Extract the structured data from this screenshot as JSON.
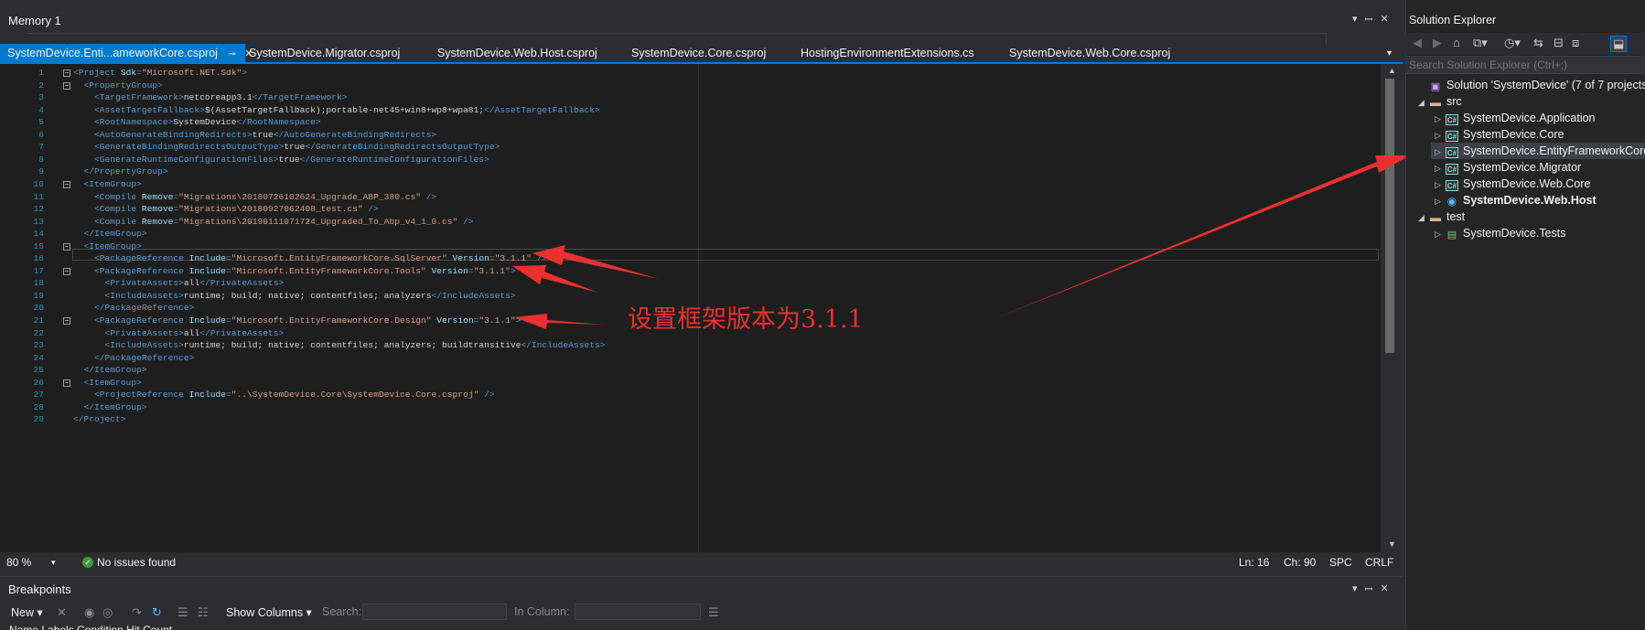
{
  "memory_panel": {
    "title": "Memory 1",
    "pin_icon": "▾ ⨯"
  },
  "tabs": [
    {
      "label": "SystemDevice.Enti...ameworkCore.csproj",
      "active": true
    },
    {
      "label": "SystemDevice.Migrator.csproj"
    },
    {
      "label": "SystemDevice.Web.Host.csproj"
    },
    {
      "label": "SystemDevice.Core.csproj"
    },
    {
      "label": "HostingEnvironmentExtensions.cs"
    },
    {
      "label": "SystemDevice.Web.Core.csproj"
    }
  ],
  "editor": {
    "line_numbers": [
      "1",
      "2",
      "3",
      "4",
      "5",
      "6",
      "7",
      "8",
      "9",
      "10",
      "11",
      "12",
      "13",
      "14",
      "15",
      "16",
      "17",
      "18",
      "19",
      "20",
      "21",
      "22",
      "23",
      "24",
      "25",
      "26",
      "27",
      "28",
      "29"
    ],
    "lines": [
      [
        [
          "t",
          "<Project "
        ],
        [
          "a",
          "Sdk"
        ],
        [
          "p",
          "="
        ],
        [
          "v",
          "\"Microsoft.NET.Sdk\""
        ],
        [
          "t",
          ">"
        ]
      ],
      [
        [
          "t",
          "  <PropertyGroup>"
        ]
      ],
      [
        [
          "t",
          "    <TargetFramework>"
        ],
        [
          "x",
          "netcoreapp3.1"
        ],
        [
          "t",
          "</TargetFramework>"
        ]
      ],
      [
        [
          "t",
          "    <AssetTargetFallback>"
        ],
        [
          "x",
          "$(AssetTargetFallback);portable-net45+win8+wp8+wpa81;"
        ],
        [
          "t",
          "</AssetTargetFallback>"
        ]
      ],
      [
        [
          "t",
          "    <RootNamespace>"
        ],
        [
          "x",
          "SystemDevice"
        ],
        [
          "t",
          "</RootNamespace>"
        ]
      ],
      [
        [
          "t",
          "    <AutoGenerateBindingRedirects>"
        ],
        [
          "x",
          "true"
        ],
        [
          "t",
          "</AutoGenerateBindingRedirects>"
        ]
      ],
      [
        [
          "t",
          "    <GenerateBindingRedirectsOutputType>"
        ],
        [
          "x",
          "true"
        ],
        [
          "t",
          "</GenerateBindingRedirectsOutputType>"
        ]
      ],
      [
        [
          "t",
          "    <GenerateRuntimeConfigurationFiles>"
        ],
        [
          "x",
          "true"
        ],
        [
          "t",
          "</GenerateRuntimeConfigurationFiles>"
        ]
      ],
      [
        [
          "t",
          "  </PropertyGroup>"
        ]
      ],
      [
        [
          "t",
          "  <ItemGroup>"
        ]
      ],
      [
        [
          "t",
          "    <Compile "
        ],
        [
          "a",
          "Remove"
        ],
        [
          "p",
          "="
        ],
        [
          "v",
          "\"Migrations\\20180726102624_Upgrade_ABP_380.cs\""
        ],
        [
          "t",
          " />"
        ]
      ],
      [
        [
          "t",
          "    <Compile "
        ],
        [
          "a",
          "Remove"
        ],
        [
          "p",
          "="
        ],
        [
          "v",
          "\"Migrations\\20180927062408_test.cs\""
        ],
        [
          "t",
          " />"
        ]
      ],
      [
        [
          "t",
          "    <Compile "
        ],
        [
          "a",
          "Remove"
        ],
        [
          "p",
          "="
        ],
        [
          "v",
          "\"Migrations\\20190111071724_Upgraded_To_Abp_v4_1_0.cs\""
        ],
        [
          "t",
          " />"
        ]
      ],
      [
        [
          "t",
          "  </ItemGroup>"
        ]
      ],
      [
        [
          "t",
          "  <ItemGroup>"
        ]
      ],
      [
        [
          "t",
          "    <PackageReference "
        ],
        [
          "a",
          "Include"
        ],
        [
          "p",
          "="
        ],
        [
          "v",
          "\"Microsoft.EntityFrameworkCore.SqlServer\""
        ],
        [
          "a",
          " Version"
        ],
        [
          "p",
          "="
        ],
        [
          "v",
          "\"3.1.1\""
        ],
        [
          "t",
          " />"
        ]
      ],
      [
        [
          "t",
          "    <PackageReference "
        ],
        [
          "a",
          "Include"
        ],
        [
          "p",
          "="
        ],
        [
          "v",
          "\"Microsoft.EntityFrameworkCore.Tools\""
        ],
        [
          "a",
          " Version"
        ],
        [
          "p",
          "="
        ],
        [
          "v",
          "\"3.1.1\""
        ],
        [
          "t",
          ">"
        ]
      ],
      [
        [
          "t",
          "      <PrivateAssets>"
        ],
        [
          "x",
          "all"
        ],
        [
          "t",
          "</PrivateAssets>"
        ]
      ],
      [
        [
          "t",
          "      <IncludeAssets>"
        ],
        [
          "x",
          "runtime; build; native; contentfiles; analyzers"
        ],
        [
          "t",
          "</IncludeAssets>"
        ]
      ],
      [
        [
          "t",
          "    </PackageReference>"
        ]
      ],
      [
        [
          "t",
          "    <PackageReference "
        ],
        [
          "a",
          "Include"
        ],
        [
          "p",
          "="
        ],
        [
          "v",
          "\"Microsoft.EntityFrameworkCore.Design\""
        ],
        [
          "a",
          " Version"
        ],
        [
          "p",
          "="
        ],
        [
          "v",
          "\"3.1.1\""
        ],
        [
          "t",
          ">"
        ]
      ],
      [
        [
          "t",
          "      <PrivateAssets>"
        ],
        [
          "x",
          "all"
        ],
        [
          "t",
          "</PrivateAssets>"
        ]
      ],
      [
        [
          "t",
          "      <IncludeAssets>"
        ],
        [
          "x",
          "runtime; build; native; contentfiles; analyzers; buildtransitive"
        ],
        [
          "t",
          "</IncludeAssets>"
        ]
      ],
      [
        [
          "t",
          "    </PackageReference>"
        ]
      ],
      [
        [
          "t",
          "  </ItemGroup>"
        ]
      ],
      [
        [
          "t",
          "  <ItemGroup>"
        ]
      ],
      [
        [
          "t",
          "    <ProjectReference "
        ],
        [
          "a",
          "Include"
        ],
        [
          "p",
          "="
        ],
        [
          "v",
          "\"..\\SystemDevice.Core\\SystemDevice.Core.csproj\""
        ],
        [
          "t",
          " />"
        ]
      ],
      [
        [
          "t",
          "  </ItemGroup>"
        ]
      ],
      [
        [
          "t",
          "</Project>"
        ]
      ]
    ]
  },
  "annotation": {
    "text": "设置框架版本为3.1.1",
    "color": "#e8312f"
  },
  "status_bar": {
    "zoom": "80 %",
    "issues": "No issues found",
    "line": "Ln: 16",
    "col": "Ch: 90",
    "whitespace": "SPC",
    "eol": "CRLF"
  },
  "breakpoints": {
    "title": "Breakpoints",
    "new_label": "New",
    "show_columns_label": "Show Columns",
    "search_label": "Search:",
    "in_column_label": "In Column:",
    "columns_row": "Name    Labels    Condition    Hit Count"
  },
  "solution_explorer": {
    "title": "Solution Explorer",
    "search_placeholder": "Search Solution Explorer (Ctrl+;)",
    "items": [
      {
        "label": "Solution 'SystemDevice' (7 of 7 projects)",
        "icon": "solution-icon",
        "caret": ""
      },
      {
        "label": "src",
        "icon": "folder-icon",
        "caret": "◢"
      },
      {
        "label": "SystemDevice.Application",
        "icon": "csharp-project-icon",
        "caret": "▷"
      },
      {
        "label": "SystemDevice.Core",
        "icon": "csharp-project-icon",
        "caret": "▷"
      },
      {
        "label": "SystemDevice.EntityFrameworkCore",
        "icon": "csharp-project-icon",
        "caret": "▷",
        "selected": true
      },
      {
        "label": "SystemDevice.Migrator",
        "icon": "csharp-project-icon",
        "caret": "▷"
      },
      {
        "label": "SystemDevice.Web.Core",
        "icon": "csharp-project-icon",
        "caret": "▷"
      },
      {
        "label": "SystemDevice.Web.Host",
        "icon": "web-project-icon",
        "caret": "▷",
        "bold": true
      },
      {
        "label": "test",
        "icon": "folder-icon",
        "caret": "◢"
      },
      {
        "label": "SystemDevice.Tests",
        "icon": "test-project-icon",
        "caret": "▷"
      }
    ]
  }
}
